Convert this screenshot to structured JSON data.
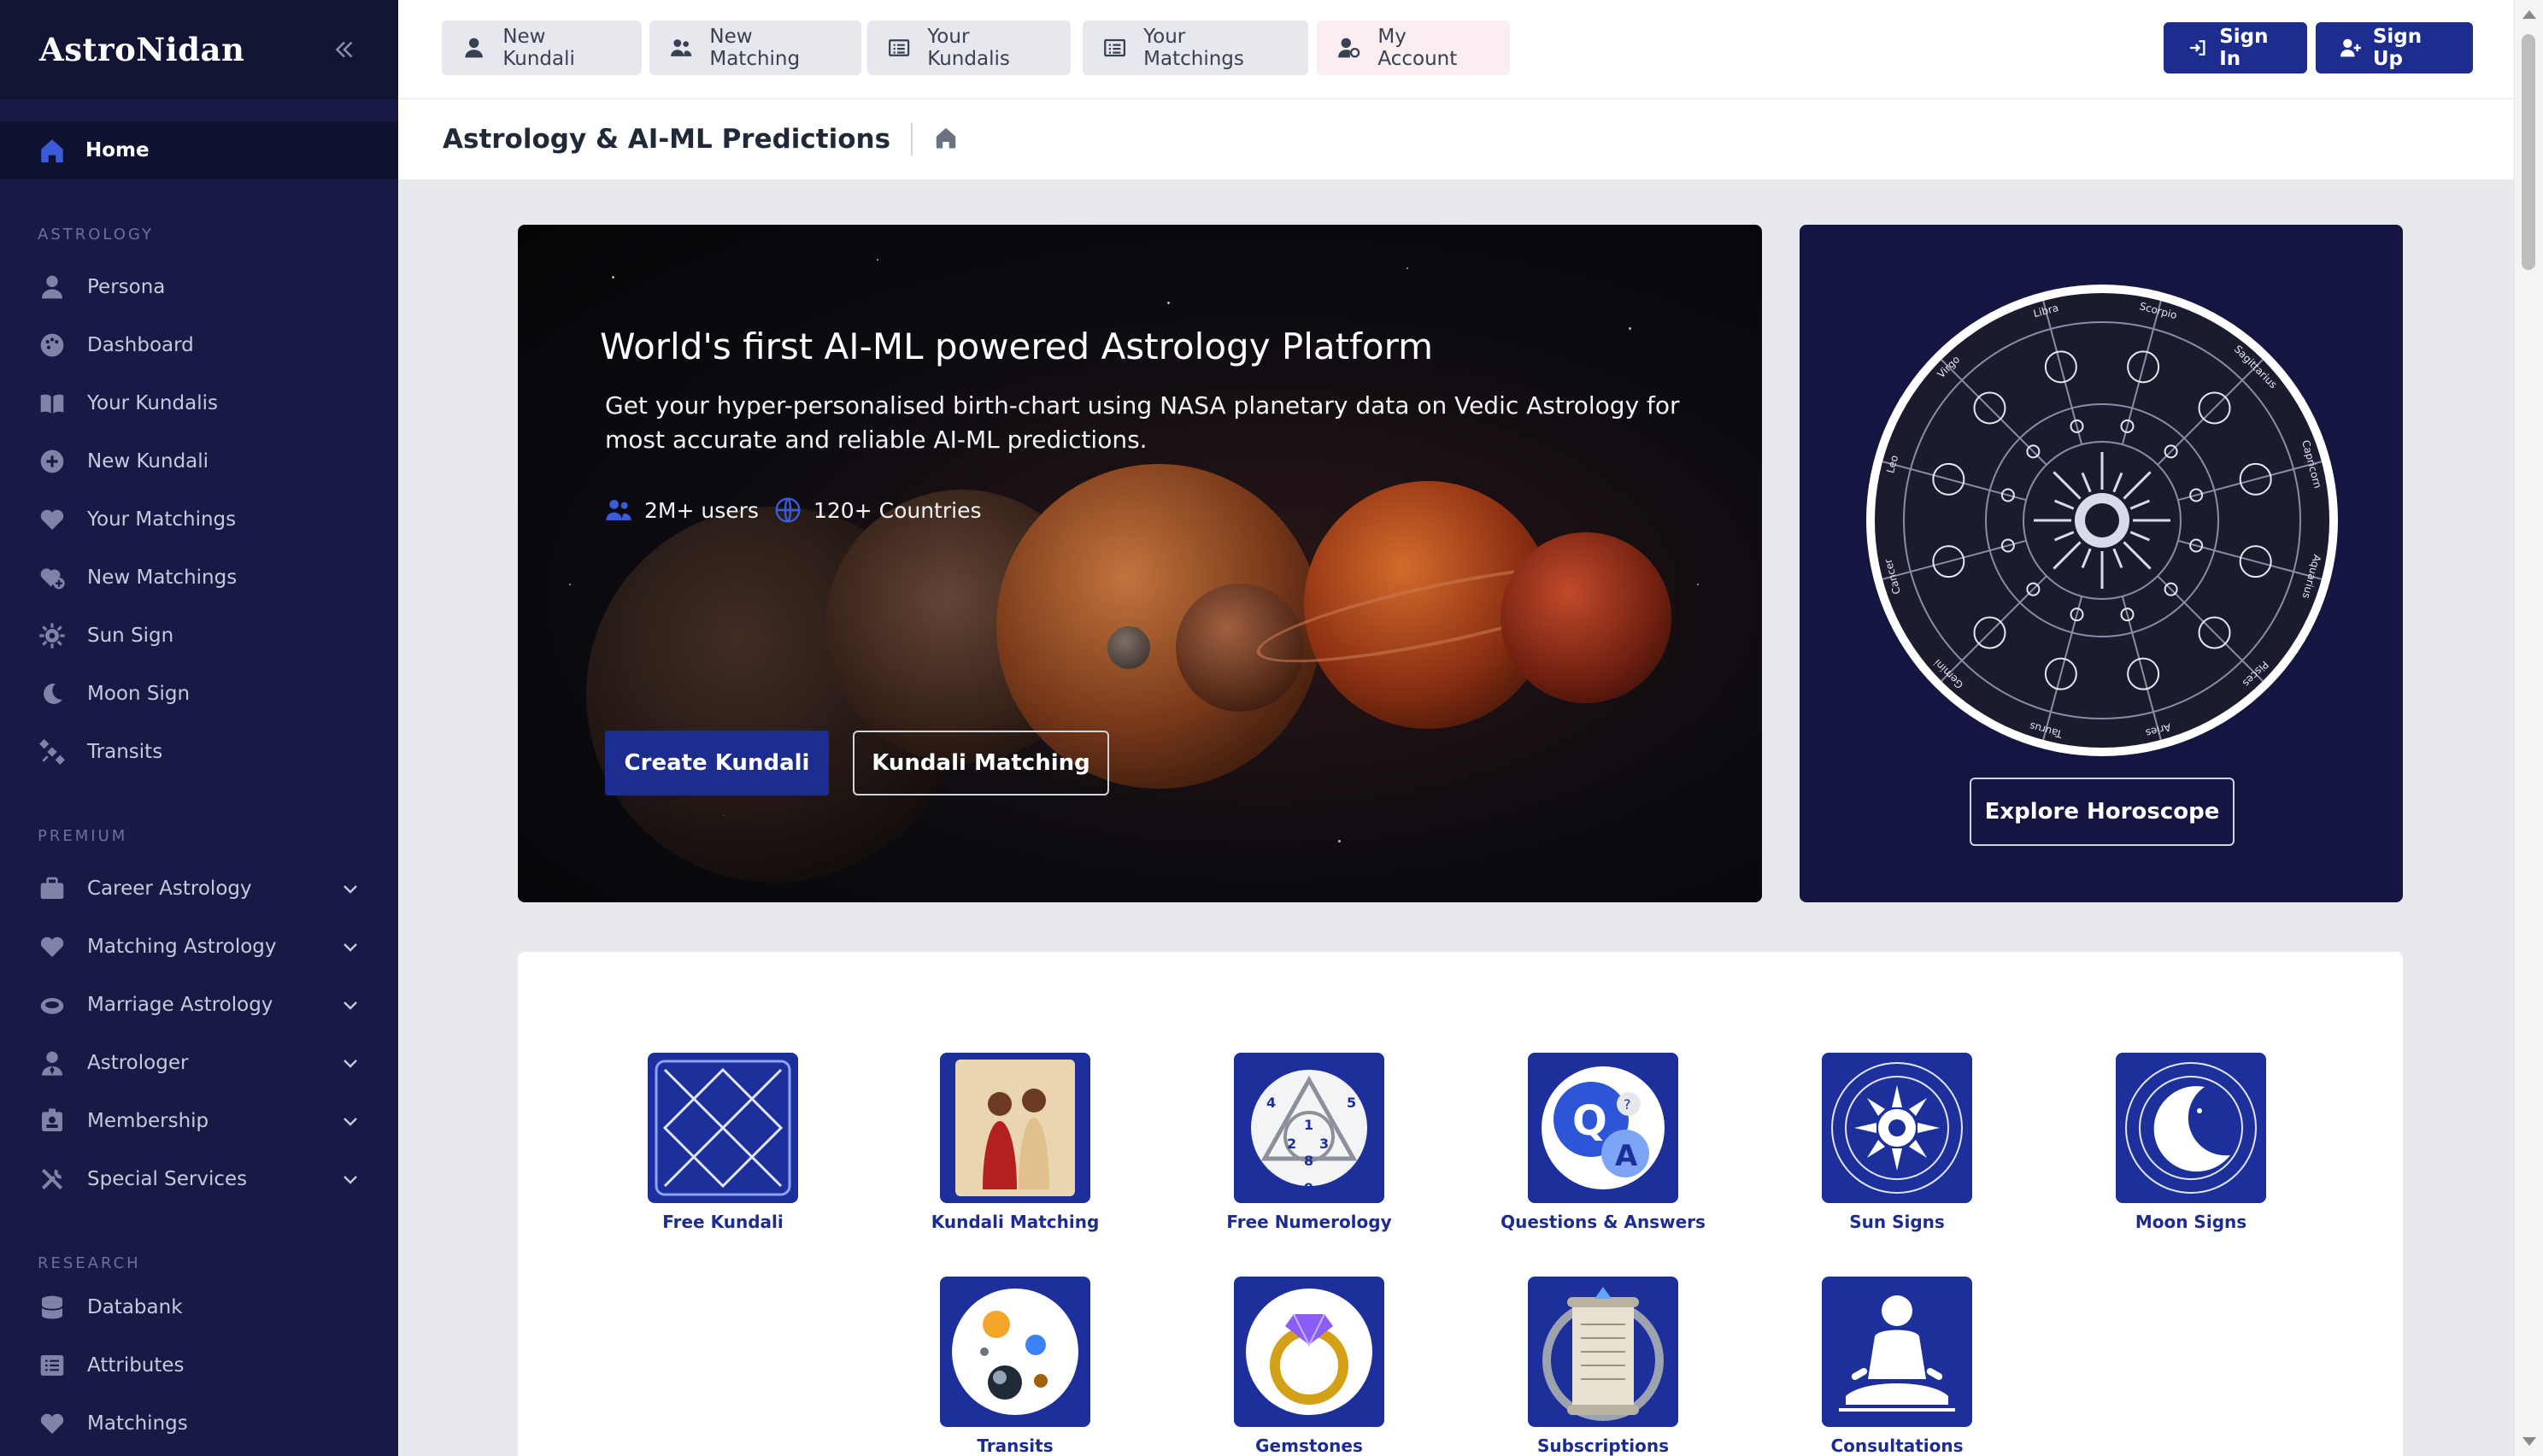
{
  "app": {
    "logo": "AstroNidan"
  },
  "sidebar": {
    "home_label": "Home",
    "sections": {
      "astrology": "ASTROLOGY",
      "premium": "PREMIUM",
      "research": "RESEARCH"
    },
    "astrology_items": [
      {
        "label": "Persona",
        "icon": "user-icon"
      },
      {
        "label": "Dashboard",
        "icon": "palette-icon"
      },
      {
        "label": "Your Kundalis",
        "icon": "book-open-icon"
      },
      {
        "label": "New Kundali",
        "icon": "plus-circle-icon"
      },
      {
        "label": "Your Matchings",
        "icon": "heart-icon"
      },
      {
        "label": "New Matchings",
        "icon": "heart-plus-icon"
      },
      {
        "label": "Sun Sign",
        "icon": "sun-gear-icon"
      },
      {
        "label": "Moon Sign",
        "icon": "moon-icon"
      },
      {
        "label": "Transits",
        "icon": "satellite-icon"
      }
    ],
    "premium_items": [
      {
        "label": "Career Astrology",
        "icon": "briefcase-icon"
      },
      {
        "label": "Matching Astrology",
        "icon": "heart-icon"
      },
      {
        "label": "Marriage Astrology",
        "icon": "ring-icon"
      },
      {
        "label": "Astrologer",
        "icon": "user-tie-icon"
      },
      {
        "label": "Membership",
        "icon": "id-badge-icon"
      },
      {
        "label": "Special Services",
        "icon": "tools-icon"
      }
    ],
    "research_items": [
      {
        "label": "Databank",
        "icon": "database-icon"
      },
      {
        "label": "Attributes",
        "icon": "list-icon"
      },
      {
        "label": "Matchings",
        "icon": "heart-icon"
      }
    ]
  },
  "topbar": {
    "new_kundali": "New Kundali",
    "new_matching": "New Matching",
    "your_kundalis": "Your Kundalis",
    "your_matchings": "Your Matchings",
    "my_account": "My Account",
    "sign_in": "Sign In",
    "sign_up": "Sign Up"
  },
  "page": {
    "title": "Astrology & AI-ML Predictions"
  },
  "hero": {
    "title": "World's first AI-ML powered Astrology Platform",
    "subtitle": "Get your hyper-personalised birth-chart using NASA planetary data on Vedic Astrology for most accurate and reliable AI-ML predictions.",
    "users": "2M+ users",
    "countries": "120+ Countries",
    "create_btn": "Create Kundali",
    "match_btn": "Kundali Matching"
  },
  "horoscope": {
    "explore_btn": "Explore Horoscope",
    "signs": [
      "Libra",
      "Scorpio",
      "Sagittarius",
      "Capricorn",
      "Aquarius",
      "Pisces",
      "Aries",
      "Taurus",
      "Gemini",
      "Cancer",
      "Leo",
      "Virgo"
    ]
  },
  "services": [
    {
      "label": "Free Kundali",
      "icon": "kundali-chart-icon"
    },
    {
      "label": "Kundali Matching",
      "icon": "wedding-couple-icon"
    },
    {
      "label": "Free Numerology",
      "icon": "numerology-icon"
    },
    {
      "label": "Questions & Answers",
      "icon": "qa-bubble-icon"
    },
    {
      "label": "Sun Signs",
      "icon": "sun-zodiac-icon"
    },
    {
      "label": "Moon Signs",
      "icon": "moon-zodiac-icon"
    },
    {
      "label": "Transits",
      "icon": "planets-icon"
    },
    {
      "label": "Gemstones",
      "icon": "gem-ring-icon"
    },
    {
      "label": "Subscriptions",
      "icon": "scroll-icon"
    },
    {
      "label": "Consultations",
      "icon": "meditation-icon"
    }
  ],
  "colors": {
    "sidebar_bg": "#171a45",
    "brand_blue": "#1d2c8f",
    "tile_blue": "#1d2f9a",
    "horoscope_bg": "#141541"
  }
}
